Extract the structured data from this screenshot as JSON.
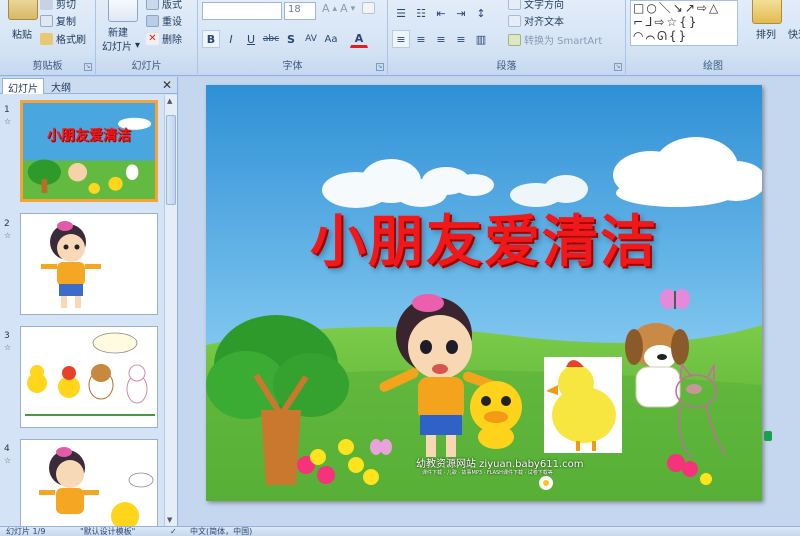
{
  "ribbon": {
    "clipboard": {
      "label": "剪贴板",
      "paste": "粘贴",
      "cut": "剪切",
      "copy": "复制",
      "format_painter": "格式刷"
    },
    "slides": {
      "label": "幻灯片",
      "new_slide_line1": "新建",
      "new_slide_line2": "幻灯片",
      "layout": "版式",
      "reset": "重设",
      "delete": "删除"
    },
    "font": {
      "label": "字体",
      "font_name": "",
      "font_size": "18",
      "bold": "B",
      "italic": "I",
      "underline": "U",
      "strike": "abc",
      "shadow": "S",
      "spacing": "AV",
      "case": "Aa",
      "color": "A"
    },
    "paragraph": {
      "label": "段落",
      "text_direction": "文字方向",
      "align_text": "对齐文本",
      "smartart": "转换为 SmartArt"
    },
    "drawing": {
      "label": "绘图",
      "arrange": "排列",
      "quick_styles": "快速"
    }
  },
  "left_panel": {
    "tabs": [
      "幻灯片",
      "大纲"
    ],
    "close": "✕",
    "thumbnails": [
      {
        "num": "1",
        "title": "小朋友爱清洁"
      },
      {
        "num": "2"
      },
      {
        "num": "3",
        "bubble": ""
      },
      {
        "num": "4"
      }
    ]
  },
  "slide": {
    "title": "小朋友爱清洁",
    "site_line1": "幼教资源网站 ziyuan.baby611.com",
    "site_line2": "课件下载 · 儿歌 · 故事MP3 · FLASH课件下载 · 试卷下载等"
  },
  "status": {
    "slide_info": "幻灯片 1/9",
    "theme": "\"默认设计模板\"",
    "language": "中文(简体，中国)"
  },
  "colors": {
    "title_red": "#f01818",
    "ribbon_bg": "#d3e2f4",
    "selected_thumb": "#f4a53a",
    "sky_top": "#3a9bd8",
    "grass": "#5cb83a"
  }
}
